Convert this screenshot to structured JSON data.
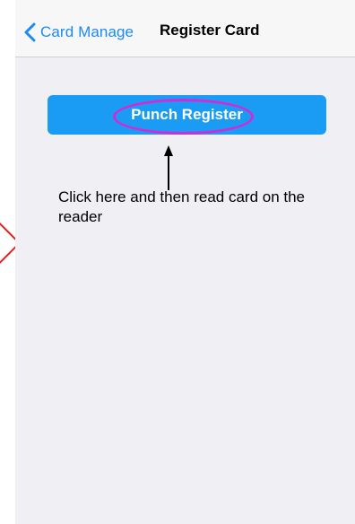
{
  "navbar": {
    "back_label": "Card Manage",
    "title": "Register Card"
  },
  "main": {
    "punch_button_label": "Punch Register",
    "instruction_text": "Click here and then read card on the reader"
  },
  "icons": {
    "back": "chevron-left-icon",
    "arrow": "arrow-up-icon"
  },
  "colors": {
    "accent": "#1a8af5",
    "button": "#1a9cf5",
    "highlight": "#d12bd6",
    "background": "#efeff4"
  }
}
